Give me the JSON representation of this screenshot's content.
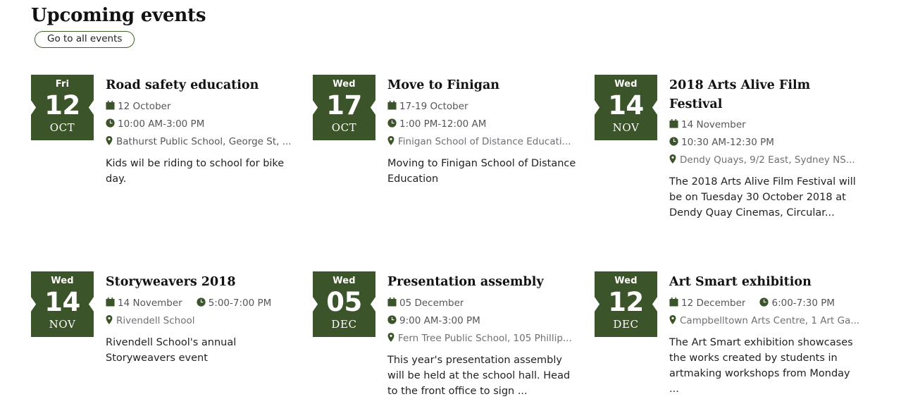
{
  "header": {
    "title": "Upcoming events",
    "all_events_label": "Go to all events"
  },
  "icons": {
    "calendar": "calendar-icon",
    "clock": "clock-icon",
    "pin": "location-pin-icon"
  },
  "colors": {
    "badge_green": "#3b5429",
    "icon_green": "#3b5429",
    "button_border": "#41632c",
    "meta_text": "#55565a",
    "title_text": "#121212"
  },
  "events": [
    {
      "dow": "Fri",
      "day": "12",
      "month": "OCT",
      "title": "Road safety education",
      "date": "12 October",
      "time": "10:00 AM-3:00 PM",
      "location": "Bathurst Public School, George St, ...",
      "description": "Kids wil be riding to school for bike day."
    },
    {
      "dow": "Wed",
      "day": "17",
      "month": "OCT",
      "title": "Move to Finigan",
      "date": "17-19 October",
      "time": "1:00 PM-12:00 AM",
      "location": "Finigan School of Distance Educati...",
      "description": "Moving to Finigan School of Distance Education"
    },
    {
      "dow": "Wed",
      "day": "14",
      "month": "NOV",
      "title": "2018 Arts Alive Film Festival",
      "date": "14 November",
      "time": "10:30 AM-12:30 PM",
      "location": "Dendy Quays, 9/2 East, Sydney NS...",
      "description": "The 2018 Arts Alive Film Festival will be on Tuesday 30 October 2018 at Dendy Quay Cinemas, Circular..."
    },
    {
      "dow": "Wed",
      "day": "14",
      "month": "NOV",
      "title": "Storyweavers 2018",
      "date": "14 November",
      "time": "5:00-7:00 PM",
      "location": "Rivendell School",
      "description": "Rivendell School's annual Storyweavers event"
    },
    {
      "dow": "Wed",
      "day": "05",
      "month": "DEC",
      "title": "Presentation assembly",
      "date": "05 December",
      "time": "9:00 AM-3:00 PM",
      "location": "Fern Tree Public School, 105 Phillip...",
      "description": "This year's presentation assembly will be held at the school hall. Head to the front office to sign ..."
    },
    {
      "dow": "Wed",
      "day": "12",
      "month": "DEC",
      "title": "Art Smart exhibition",
      "date": "12 December",
      "time": "6:00-7:30 PM",
      "location": "Campbelltown Arts Centre, 1 Art Ga...",
      "description": "The Art Smart exhibition showcases the works created by students in artmaking workshops from Monday ..."
    }
  ]
}
